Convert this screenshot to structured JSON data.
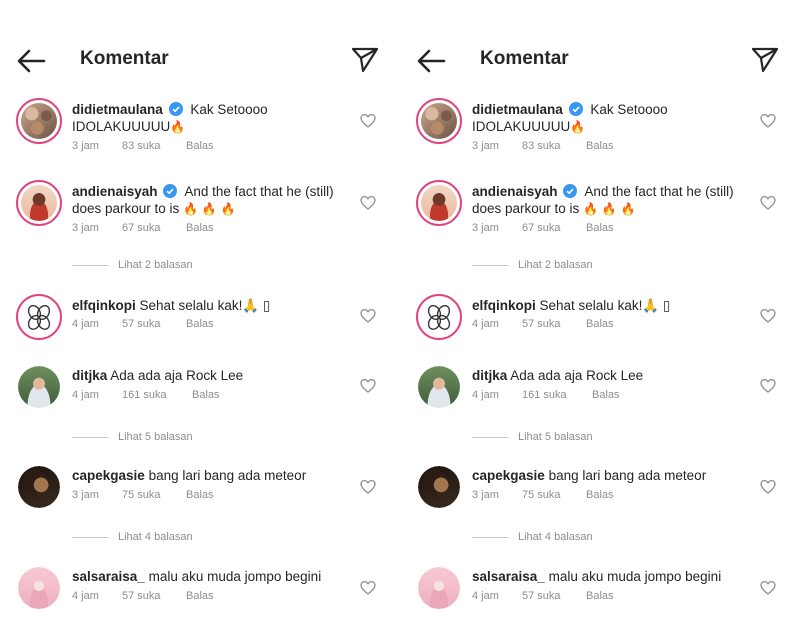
{
  "header": {
    "title": "Komentar"
  },
  "comments": [
    {
      "username": "didietmaulana",
      "verified": true,
      "text": "Kak Setoooo IDOLAKUUUUU",
      "emoji": "🔥",
      "time": "3 jam",
      "likes": "83 suka",
      "reply": "Balas",
      "avatar": "photo-collage"
    },
    {
      "username": "andienaisyah",
      "verified": true,
      "text": "And the fact that he (still) does parkour to is",
      "emoji": "🔥 🔥 🔥",
      "time": "3 jam",
      "likes": "67 suka",
      "reply": "Balas",
      "avatar": "photo-woman"
    },
    {
      "username": "elfqinkopi",
      "verified": false,
      "text": "Sehat selalu kak!🙏 ▯",
      "emoji": "",
      "time": "4 jam",
      "likes": "57 suka",
      "reply": "Balas",
      "avatar": "coffee-logo"
    },
    {
      "username": "ditjka",
      "verified": false,
      "text": "Ada ada aja Rock Lee",
      "emoji": "",
      "time": "4 jam",
      "likes": "161 suka",
      "reply": "Balas",
      "avatar": "photo-man-outdoor"
    },
    {
      "username": "capekgasie",
      "verified": false,
      "text": "bang lari bang ada meteor",
      "emoji": "",
      "time": "3 jam",
      "likes": "75 suka",
      "reply": "Balas",
      "avatar": "photo-portrait-dark"
    },
    {
      "username": "salsaraisa_",
      "verified": false,
      "text": "malu aku muda jompo begini",
      "emoji": "",
      "time": "4 jam",
      "likes": "57 suka",
      "reply": "Balas",
      "avatar": "photo-pink"
    }
  ],
  "view_replies": [
    "Lihat 2 balasan",
    "Lihat 5 balasan",
    "Lihat 4 balasan"
  ],
  "colors": {
    "text": "#262626",
    "meta": "#8e8e8e",
    "verified": "#3897f0",
    "story_ring": "#e0447e"
  }
}
